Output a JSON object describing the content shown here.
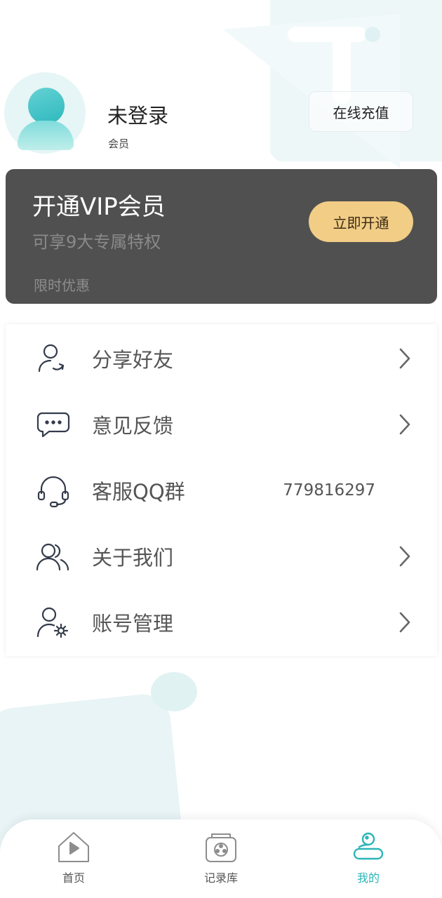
{
  "profile": {
    "name": "未登录",
    "tag": "会员",
    "recharge_label": "在线充值"
  },
  "vip": {
    "title": "开通VIP会员",
    "subtitle": "可享9大专属特权",
    "promo": "限时优惠",
    "button_label": "立即开通",
    "colors": {
      "card": "#505050",
      "button": "#f2cd86"
    }
  },
  "menu": {
    "items": [
      {
        "label": "分享好友",
        "icon": "share-user-icon",
        "value": ""
      },
      {
        "label": "意见反馈",
        "icon": "feedback-chat-icon",
        "value": ""
      },
      {
        "label": "客服QQ群",
        "icon": "headset-icon",
        "value": "779816297"
      },
      {
        "label": "关于我们",
        "icon": "users-icon",
        "value": ""
      },
      {
        "label": "账号管理",
        "icon": "user-settings-icon",
        "value": ""
      }
    ]
  },
  "tabbar": {
    "accent": "#2bb5b8",
    "tabs": [
      {
        "label": "首页",
        "icon": "home-play-icon",
        "active": false
      },
      {
        "label": "记录库",
        "icon": "film-box-icon",
        "active": false
      },
      {
        "label": "我的",
        "icon": "profile-icon",
        "active": true
      }
    ]
  }
}
